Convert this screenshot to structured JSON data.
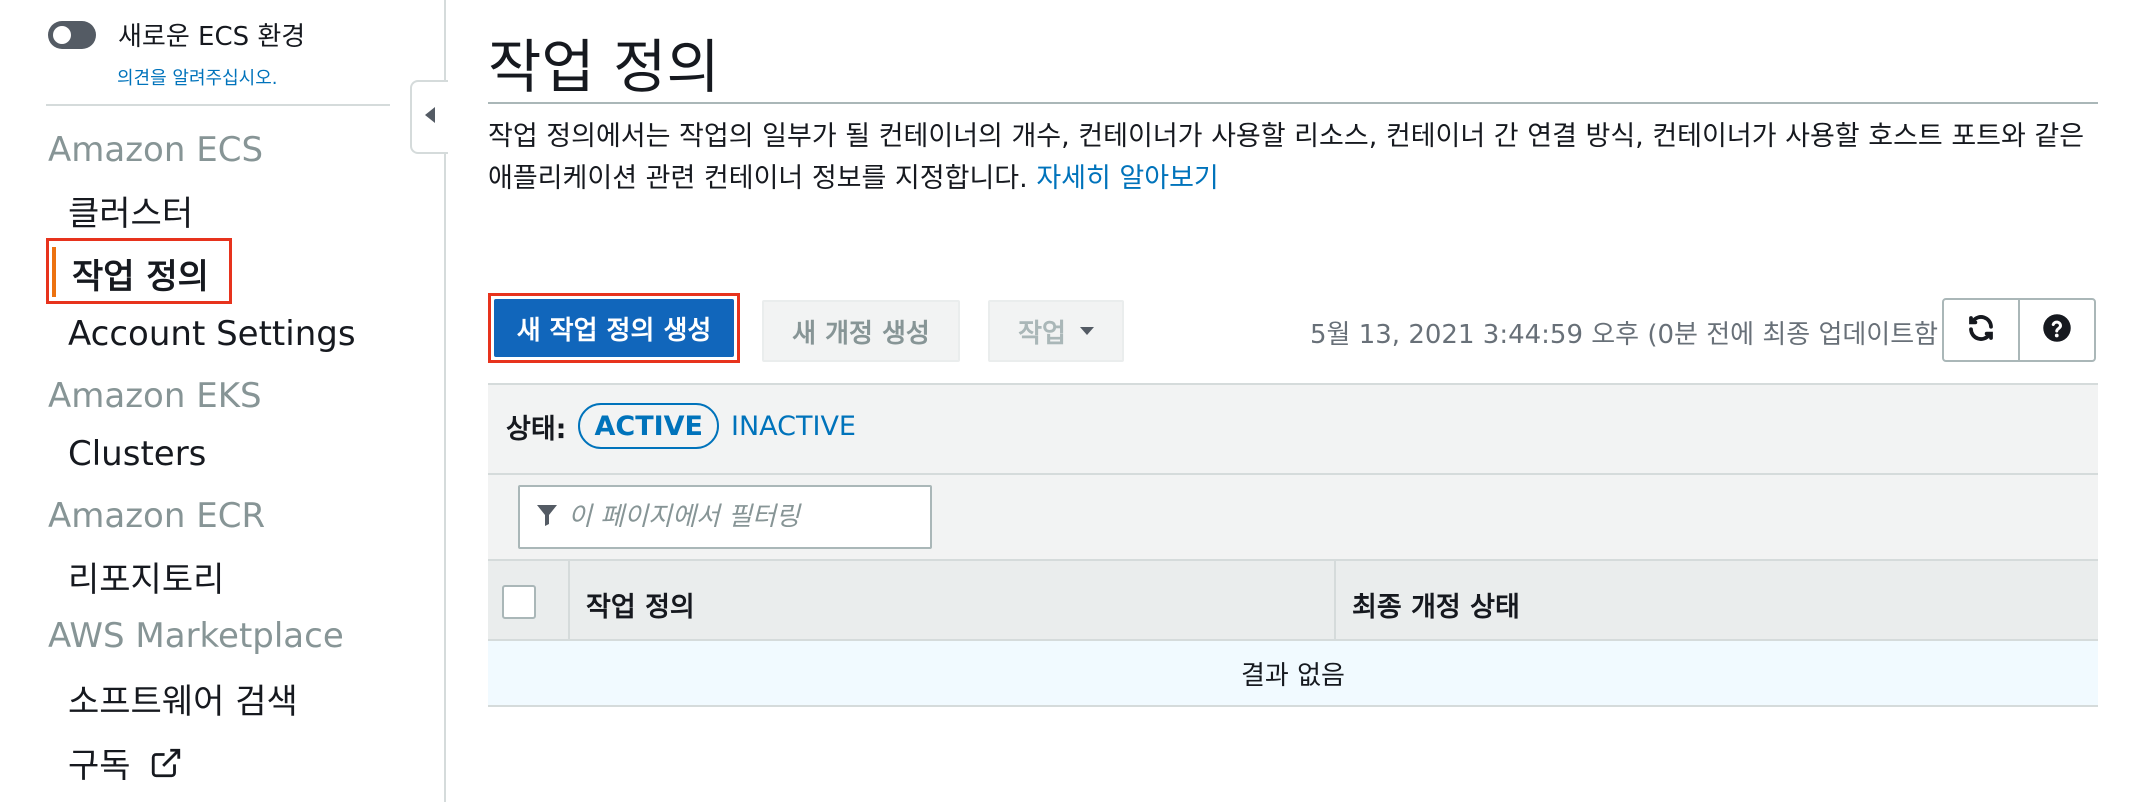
{
  "sidebar": {
    "toggle_label": "새로운 ECS 환경",
    "feedback_link": "의견을 알려주십시오.",
    "sections": [
      {
        "title": "Amazon ECS",
        "items": [
          "클러스터",
          "작업 정의",
          "Account Settings"
        ]
      },
      {
        "title": "Amazon EKS",
        "items": [
          "Clusters"
        ]
      },
      {
        "title": "Amazon ECR",
        "items": [
          "리포지토리"
        ]
      },
      {
        "title": "AWS Marketplace",
        "items": [
          "소프트웨어 검색",
          "구독"
        ]
      }
    ],
    "active_item": "작업 정의",
    "collapse_icon": "caret-left-icon",
    "external_icon": "external-link-icon"
  },
  "main": {
    "title": "작업 정의",
    "description": "작업 정의에서는 작업의 일부가 될 컨테이너의 개수, 컨테이너가 사용할 리소스, 컨테이너 간 연결 방식, 컨테이너가 사용할 호스트 포트와 같은 애플리케이션 관련 컨테이너 정보를 지정합니다.",
    "learn_more": "자세히 알아보기",
    "toolbar": {
      "create_button": "새 작업 정의 생성",
      "new_revision_button": "새 개정 생성",
      "actions_button": "작업",
      "timestamp": "5월 13, 2021 3:44:59 오후 (0분 전에 최종 업데이트함",
      "refresh_icon": "refresh-icon",
      "help_icon": "question-circle-icon"
    },
    "status_filter": {
      "label": "상태:",
      "active": "ACTIVE",
      "inactive": "INACTIVE"
    },
    "filter": {
      "placeholder": "이 페이지에서 필터링",
      "icon": "filter-icon"
    },
    "table": {
      "columns": [
        "작업 정의",
        "최종 개정 상태"
      ],
      "empty_text": "결과 없음"
    }
  },
  "colors": {
    "primary_button": "#1166bb",
    "link": "#0073bb",
    "highlight_outline": "#e7331d",
    "active_marker": "#ec7211"
  }
}
